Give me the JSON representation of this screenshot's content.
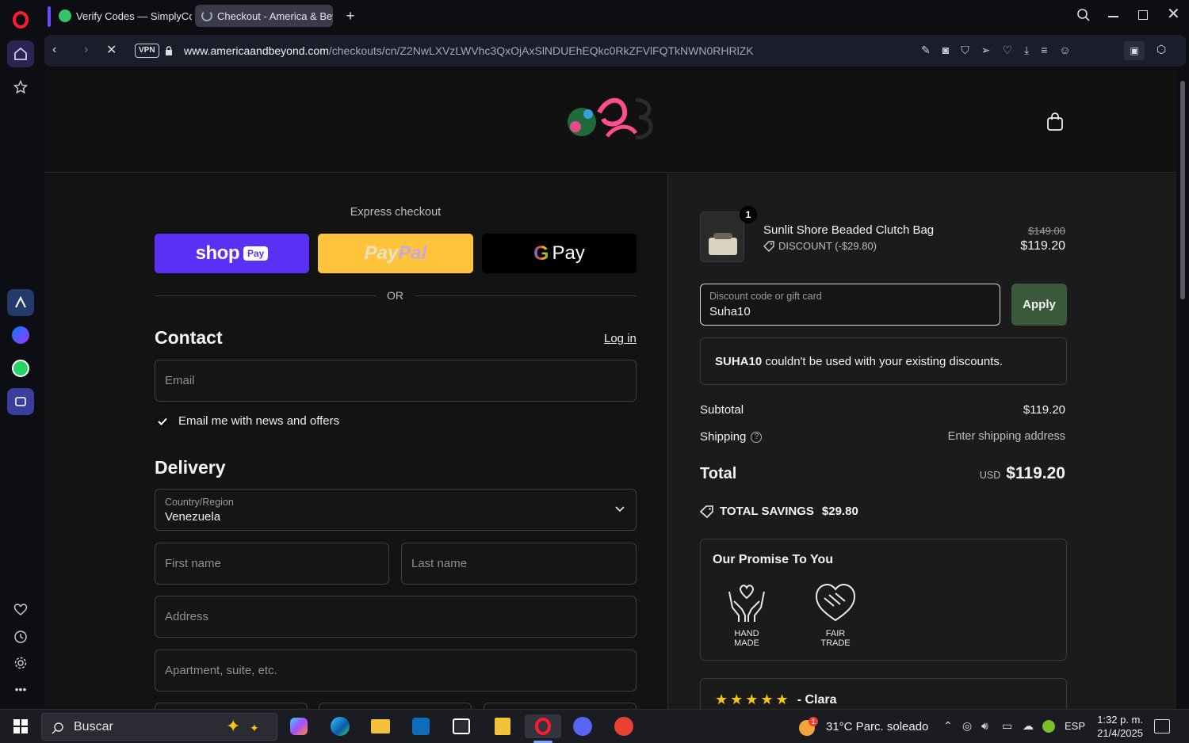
{
  "browser": {
    "tabs": [
      {
        "label": "Verify Codes — SimplyCod"
      },
      {
        "label": "Checkout - America & Bey"
      }
    ],
    "vpn_label": "VPN",
    "url_domain": "www.americaandbeyond.com",
    "url_path": "/checkouts/cn/Z2NwLXVzLWVhc3QxOjAxSlNDUEhEQkc0RkZFVlFQTkNWN0RHRlZK"
  },
  "checkout": {
    "express_label": "Express checkout",
    "shop_pay": {
      "shop": "shop",
      "pay": "Pay"
    },
    "paypal": {
      "pay": "Pay",
      "pal": "Pal"
    },
    "gpay": {
      "g": "G",
      "pay": "Pay"
    },
    "or_label": "OR",
    "contact_title": "Contact",
    "login_link": "Log in",
    "email_placeholder": "Email",
    "news_label": "Email me with news and offers",
    "delivery_title": "Delivery",
    "country_label": "Country/Region",
    "country_value": "Venezuela",
    "first_name_placeholder": "First name",
    "last_name_placeholder": "Last name",
    "address_placeholder": "Address",
    "apartment_placeholder": "Apartment, suite, etc."
  },
  "summary": {
    "item": {
      "qty": "1",
      "name": "Sunlit Shore Beaded Clutch Bag",
      "discount": "DISCOUNT (-$29.80)",
      "original_price": "$149.00",
      "price": "$119.20"
    },
    "discount_field": {
      "label": "Discount code or gift card",
      "value": "Suha10"
    },
    "apply_label": "Apply",
    "error": {
      "code": "SUHA10",
      "message": "couldn't be used with your existing discounts."
    },
    "subtotal_label": "Subtotal",
    "subtotal_value": "$119.20",
    "shipping_label": "Shipping",
    "shipping_value": "Enter shipping address",
    "total_label": "Total",
    "total_currency": "USD",
    "total_value": "$119.20",
    "savings_label": "TOTAL SAVINGS",
    "savings_value": "$29.80",
    "promise": {
      "title": "Our Promise To You",
      "badges": [
        {
          "line1": "HAND",
          "line2": "MADE"
        },
        {
          "line1": "FAIR",
          "line2": "TRADE"
        }
      ]
    },
    "review_author": "- Clara",
    "review_stars": 5
  },
  "taskbar": {
    "search_placeholder": "Buscar",
    "weather": "31°C  Parc. soleado",
    "language": "ESP",
    "time": "1:32 p. m.",
    "date": "21/4/2025"
  },
  "colors": {
    "shop_pay": "#5a31f4",
    "paypal": "#ffc439",
    "apply_btn": "#3b5a3b",
    "opera_red": "#ff1b2d"
  }
}
